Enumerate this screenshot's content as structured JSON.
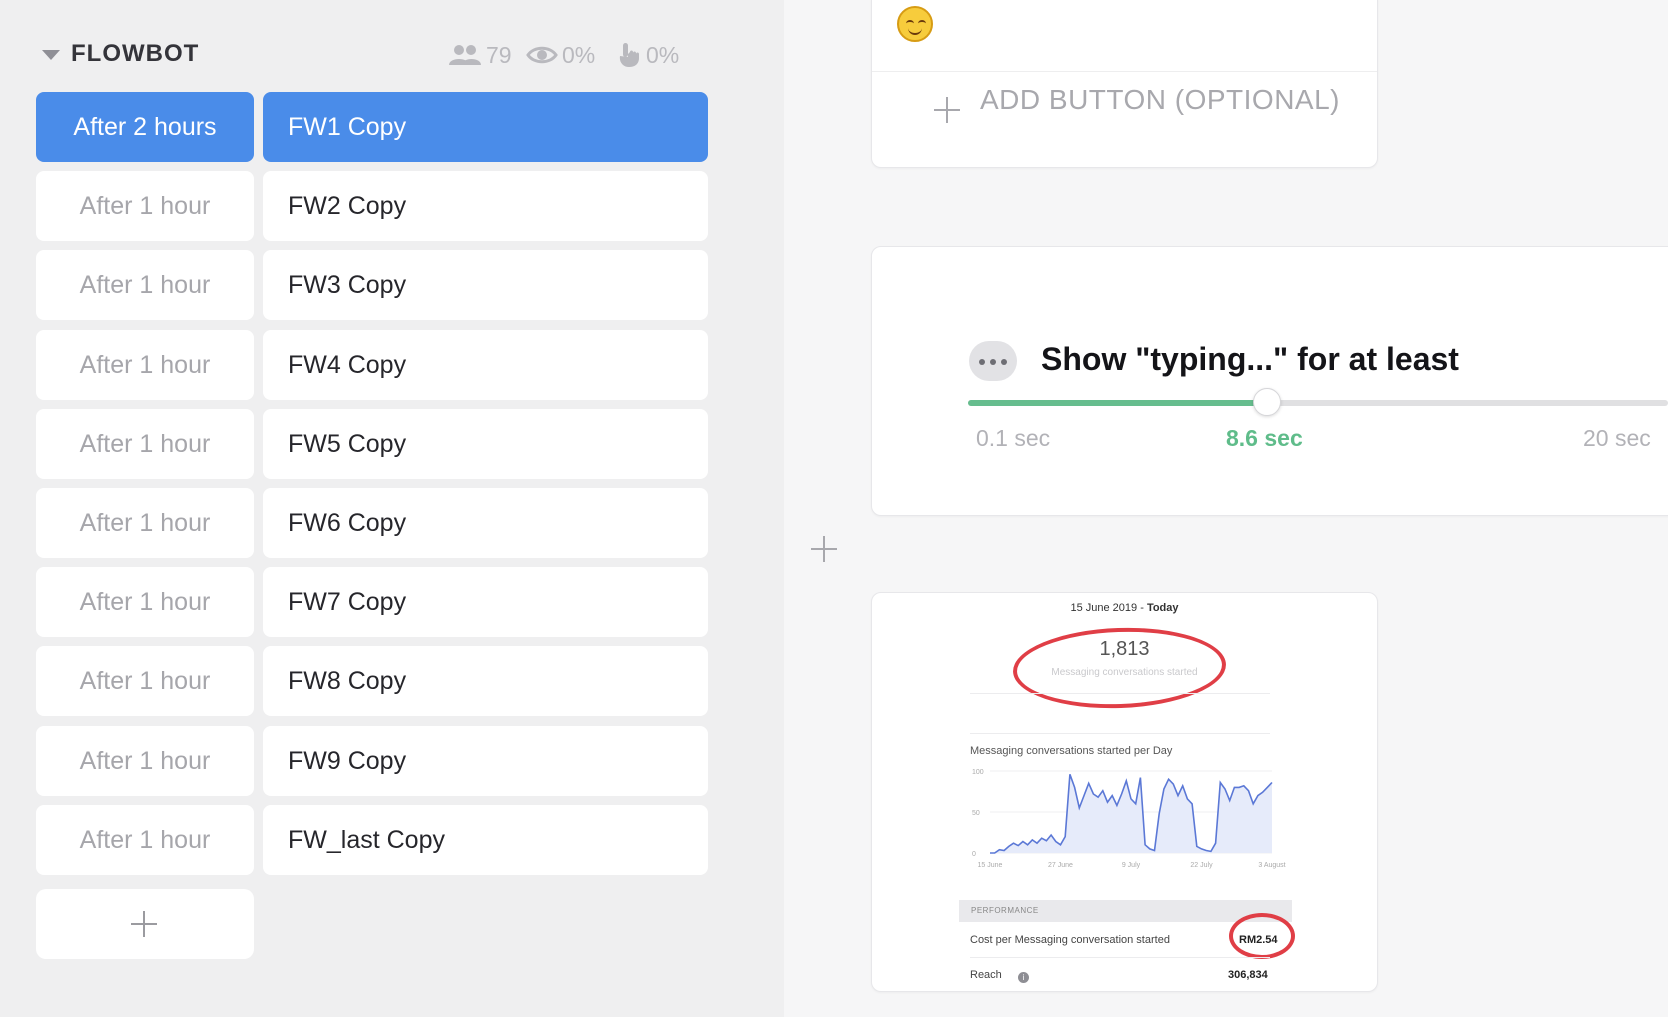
{
  "sequence": {
    "title": "FLOWBOT",
    "stats": {
      "users": "79",
      "open_rate": "0%",
      "click_rate": "0%"
    },
    "rows": [
      {
        "delay": "After 2 hours",
        "message": "FW1 Copy",
        "active": true
      },
      {
        "delay": "After 1 hour",
        "message": "FW2 Copy",
        "active": false
      },
      {
        "delay": "After 1 hour",
        "message": "FW3 Copy",
        "active": false
      },
      {
        "delay": "After 1 hour",
        "message": "FW4 Copy",
        "active": false
      },
      {
        "delay": "After 1 hour",
        "message": "FW5 Copy",
        "active": false
      },
      {
        "delay": "After 1 hour",
        "message": "FW6 Copy",
        "active": false
      },
      {
        "delay": "After 1 hour",
        "message": "FW7 Copy",
        "active": false
      },
      {
        "delay": "After 1 hour",
        "message": "FW8 Copy",
        "active": false
      },
      {
        "delay": "After 1 hour",
        "message": "FW9 Copy",
        "active": false
      },
      {
        "delay": "After 1 hour",
        "message": "FW_last Copy",
        "active": false
      }
    ]
  },
  "editor": {
    "text_card": {
      "emoji": "smiling-face-icon",
      "add_button_label": "ADD BUTTON (OPTIONAL)"
    },
    "typing_card": {
      "label": "Show \"typing...\" for at least",
      "min_label": "0.1 sec",
      "value_label": "8.6 sec",
      "max_label": "20 sec",
      "min": 0.1,
      "max": 20,
      "value": 8.6
    },
    "image_card": {
      "date_range": "15 June 2019 - ",
      "date_range_bold": "Today",
      "big_number": "1,813",
      "big_number_label": "Messaging conversations started",
      "chart_title": "Messaging conversations started per Day",
      "chart_y_ticks": [
        "100",
        "50",
        "0"
      ],
      "chart_x_ticks": [
        "15 June",
        "27 June",
        "9 July",
        "22 July",
        "3 August"
      ],
      "performance_label": "PERFORMANCE",
      "metrics": [
        {
          "label": "Cost per Messaging conversation started",
          "value": "RM2.54"
        },
        {
          "label": "Reach",
          "value": "306,834"
        }
      ]
    }
  },
  "colors": {
    "accent_blue": "#4a8ce9",
    "slider_green": "#66bd8e",
    "annotation_red": "#e03e46"
  },
  "chart_data": {
    "type": "area",
    "title": "Messaging conversations started per Day",
    "ylim": [
      0,
      100
    ],
    "y_ticks": [
      0,
      50,
      100
    ],
    "x_tick_labels": [
      "15 June",
      "27 June",
      "9 July",
      "22 July",
      "3 August"
    ],
    "x": [
      0,
      1,
      2,
      3,
      4,
      5,
      6,
      7,
      8,
      9,
      10,
      11,
      12,
      13,
      14,
      15,
      16,
      17,
      18,
      19,
      20,
      21,
      22,
      23,
      24,
      25,
      26,
      27,
      28,
      29,
      30,
      31,
      32,
      33,
      34,
      35,
      36,
      37,
      38,
      39,
      40,
      41,
      42,
      43,
      44,
      45,
      46,
      47,
      48,
      49,
      50,
      51,
      52,
      53,
      54,
      55,
      56,
      57,
      58,
      59,
      60
    ],
    "series": [
      {
        "values": [
          0,
          0,
          4,
          3,
          8,
          12,
          9,
          14,
          10,
          16,
          12,
          18,
          15,
          22,
          14,
          10,
          20,
          96,
          80,
          55,
          70,
          85,
          72,
          68,
          76,
          62,
          70,
          58,
          72,
          88,
          66,
          60,
          92,
          10,
          5,
          3,
          48,
          78,
          90,
          84,
          70,
          82,
          66,
          60,
          8,
          5,
          3,
          2,
          12,
          86,
          78,
          64,
          80,
          80,
          82,
          76,
          60,
          70,
          74,
          80,
          86
        ]
      }
    ]
  }
}
